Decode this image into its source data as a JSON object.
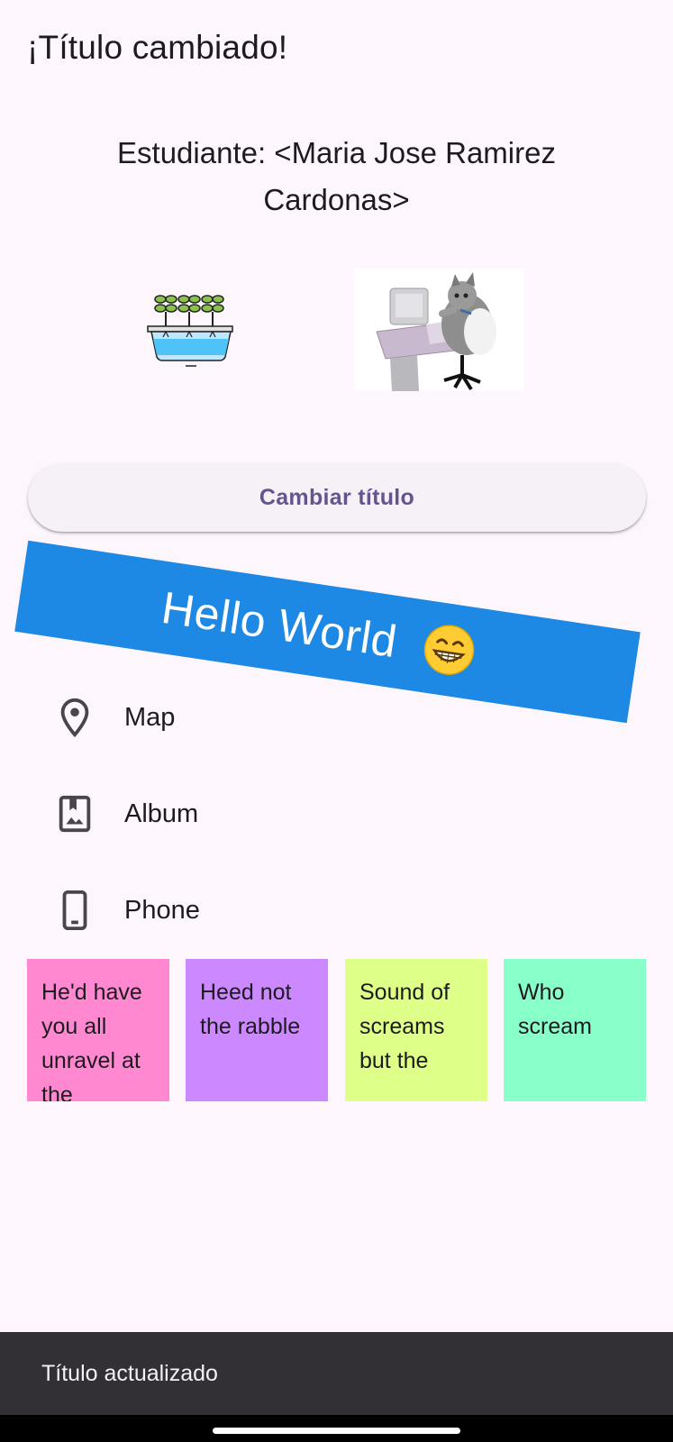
{
  "app": {
    "title": "¡Título cambiado!"
  },
  "student": {
    "text": "Estudiante: <Maria Jose Ramirez Cardonas>"
  },
  "images": [
    {
      "name": "plant-hydroponic-icon"
    },
    {
      "name": "cat-computer-photo"
    }
  ],
  "button": {
    "label": "Cambiar título"
  },
  "banner": {
    "text": "Hello World",
    "emoji_icon": "grinning-face-icon",
    "color": "#1e88e5"
  },
  "list": [
    {
      "label": "Map",
      "icon": "location-pin-icon"
    },
    {
      "label": "Album",
      "icon": "photo-album-icon"
    },
    {
      "label": "Phone",
      "icon": "phone-icon"
    }
  ],
  "tiles": [
    {
      "text": "He'd have you all unravel at the",
      "color": "#ff88d1"
    },
    {
      "text": "Heed not the rabble",
      "color": "#cc88ff"
    },
    {
      "text": "Sound of screams but the",
      "color": "#deff88"
    },
    {
      "text": "Who scream",
      "color": "#88ffc9"
    }
  ],
  "snackbar": {
    "text": "Título actualizado"
  }
}
